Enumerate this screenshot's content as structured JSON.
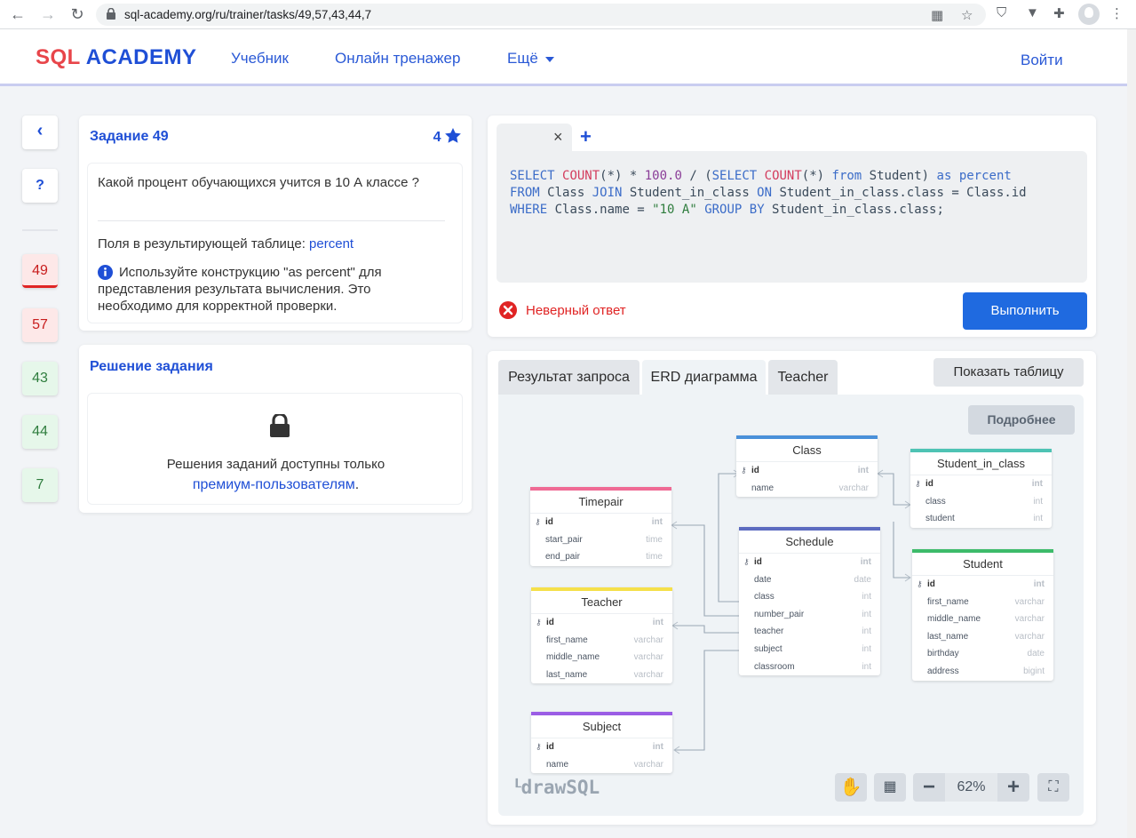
{
  "browser": {
    "url": "sql-academy.org/ru/trainer/tasks/49,57,43,44,7"
  },
  "header": {
    "logo_sql": "SQL",
    "logo_academy": "ACADEMY",
    "nav": [
      "Учебник",
      "Онлайн тренажер",
      "Ещё"
    ],
    "login": "Войти"
  },
  "sidebar": {
    "back": "‹",
    "help": "?",
    "tasks": [
      {
        "num": "49",
        "status": "wrong-active"
      },
      {
        "num": "57",
        "status": "wrong"
      },
      {
        "num": "43",
        "status": "solved"
      },
      {
        "num": "44",
        "status": "solved"
      },
      {
        "num": "7",
        "status": "solved"
      }
    ],
    "colors": {
      "wrong_bg": "#fde8e8",
      "wrong_text": "#c81e1e",
      "solved_bg": "#e6f7ea",
      "solved_text": "#2f7d3e",
      "active_border": "#e02424"
    }
  },
  "task": {
    "title": "Задание 49",
    "rating": "4",
    "question": "Какой процент обучающихся учится в 10 А классе ?",
    "fields_label": "Поля в результирующей таблице:",
    "fields_value": "percent",
    "hint": "Используйте конструкцию \"as percent\" для представления результата вычисления. Это необходимо для корректной проверки."
  },
  "solution": {
    "title": "Решение задания",
    "locked_text": "Решения заданий доступны только",
    "premium_link": "премиум-пользователям",
    "period": "."
  },
  "editor": {
    "tab_close": "×",
    "tab_add": "+",
    "code_lines": [
      "SELECT COUNT(*) * 100.0 / (SELECT COUNT(*) from Student) as percent",
      "FROM Class JOIN Student_in_class ON Student_in_class.class = Class.id",
      "WHERE Class.name = \"10 A\" GROUP BY Student_in_class.class;"
    ],
    "status": "Неверный ответ",
    "run": "Выполнить"
  },
  "results": {
    "tabs": [
      "Результат запроса",
      "ERD диаграмма",
      "Teacher"
    ],
    "active_tab": "ERD диаграмма",
    "show_table": "Показать таблицу",
    "details": "Подробнее",
    "watermark": "drawSQL",
    "zoom": "62%"
  },
  "erd": {
    "tables": [
      {
        "name": "Class",
        "color": "#4a90d9",
        "columns": [
          [
            "id",
            "int"
          ],
          [
            "name",
            "varchar"
          ]
        ]
      },
      {
        "name": "Student_in_class",
        "color": "#4ec3b4",
        "columns": [
          [
            "id",
            "int"
          ],
          [
            "class",
            "int"
          ],
          [
            "student",
            "int"
          ]
        ]
      },
      {
        "name": "Timepair",
        "color": "#ef6a94",
        "columns": [
          [
            "id",
            "int"
          ],
          [
            "start_pair",
            "time"
          ],
          [
            "end_pair",
            "time"
          ]
        ]
      },
      {
        "name": "Schedule",
        "color": "#5c6bc0",
        "columns": [
          [
            "id",
            "int"
          ],
          [
            "date",
            "date"
          ],
          [
            "class",
            "int"
          ],
          [
            "number_pair",
            "int"
          ],
          [
            "teacher",
            "int"
          ],
          [
            "subject",
            "int"
          ],
          [
            "classroom",
            "int"
          ]
        ]
      },
      {
        "name": "Student",
        "color": "#3dbb6a",
        "columns": [
          [
            "id",
            "int"
          ],
          [
            "first_name",
            "varchar"
          ],
          [
            "middle_name",
            "varchar"
          ],
          [
            "last_name",
            "varchar"
          ],
          [
            "birthday",
            "date"
          ],
          [
            "address",
            "bigint"
          ]
        ]
      },
      {
        "name": "Teacher",
        "color": "#f5e04a",
        "columns": [
          [
            "id",
            "int"
          ],
          [
            "first_name",
            "varchar"
          ],
          [
            "middle_name",
            "varchar"
          ],
          [
            "last_name",
            "varchar"
          ]
        ]
      },
      {
        "name": "Subject",
        "color": "#9b5de5",
        "columns": [
          [
            "id",
            "int"
          ],
          [
            "name",
            "varchar"
          ]
        ]
      }
    ]
  }
}
